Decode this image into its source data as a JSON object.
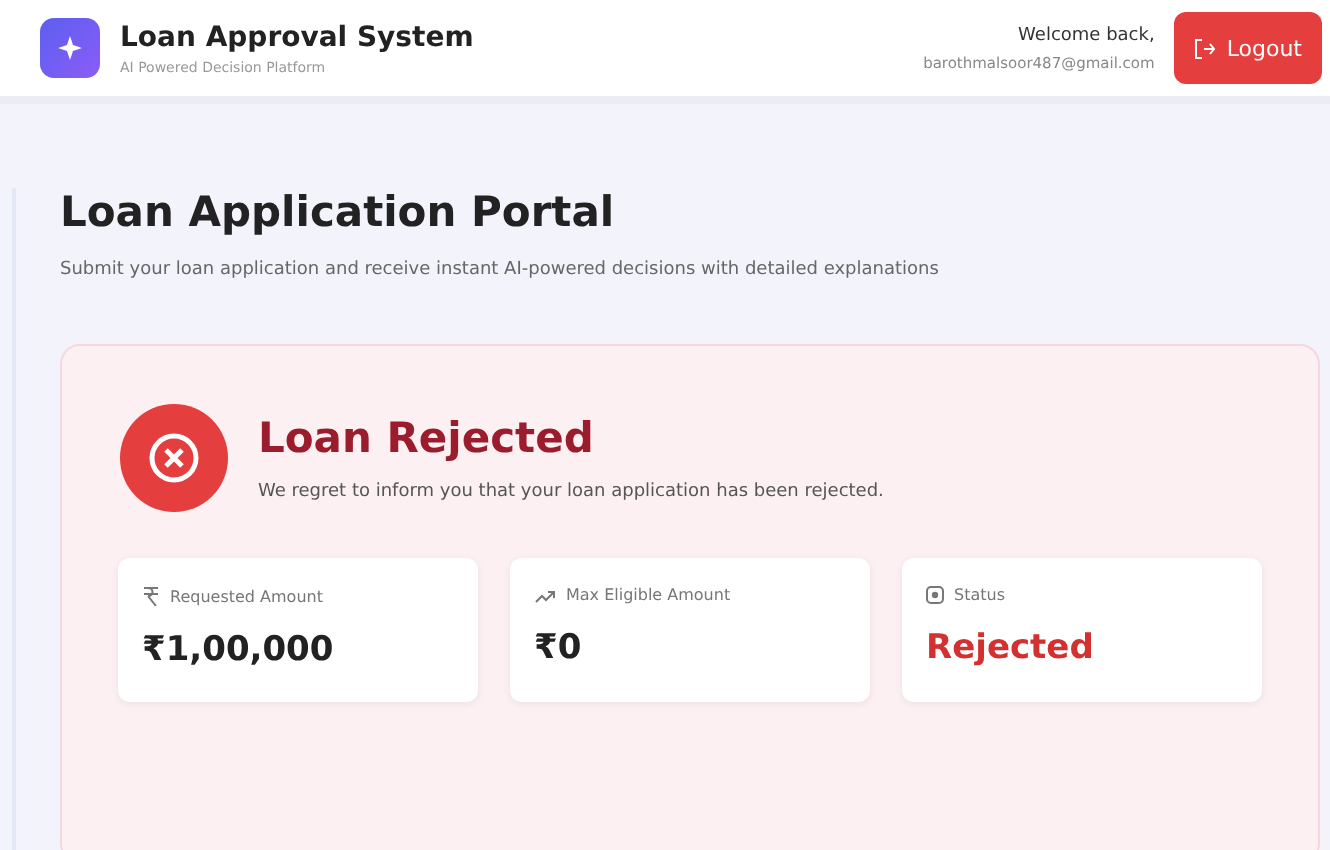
{
  "header": {
    "title": "Loan Approval System",
    "subtitle": "AI Powered Decision Platform",
    "welcome": "Welcome back,",
    "email": "barothmalsoor487@gmail.com",
    "logout": "Logout"
  },
  "page": {
    "title": "Loan Application Portal",
    "subtitle": "Submit your loan application and receive instant AI-powered decisions with detailed explanations"
  },
  "result": {
    "title": "Loan Rejected",
    "message": "We regret to inform you that your loan application has been rejected.",
    "stats": [
      {
        "kind": "rupee",
        "label": "Requested Amount",
        "value": "₹1,00,000"
      },
      {
        "kind": "trend",
        "label": "Max Eligible Amount",
        "value": "₹0"
      },
      {
        "kind": "status",
        "label": "Status",
        "value": "Rejected"
      }
    ]
  }
}
